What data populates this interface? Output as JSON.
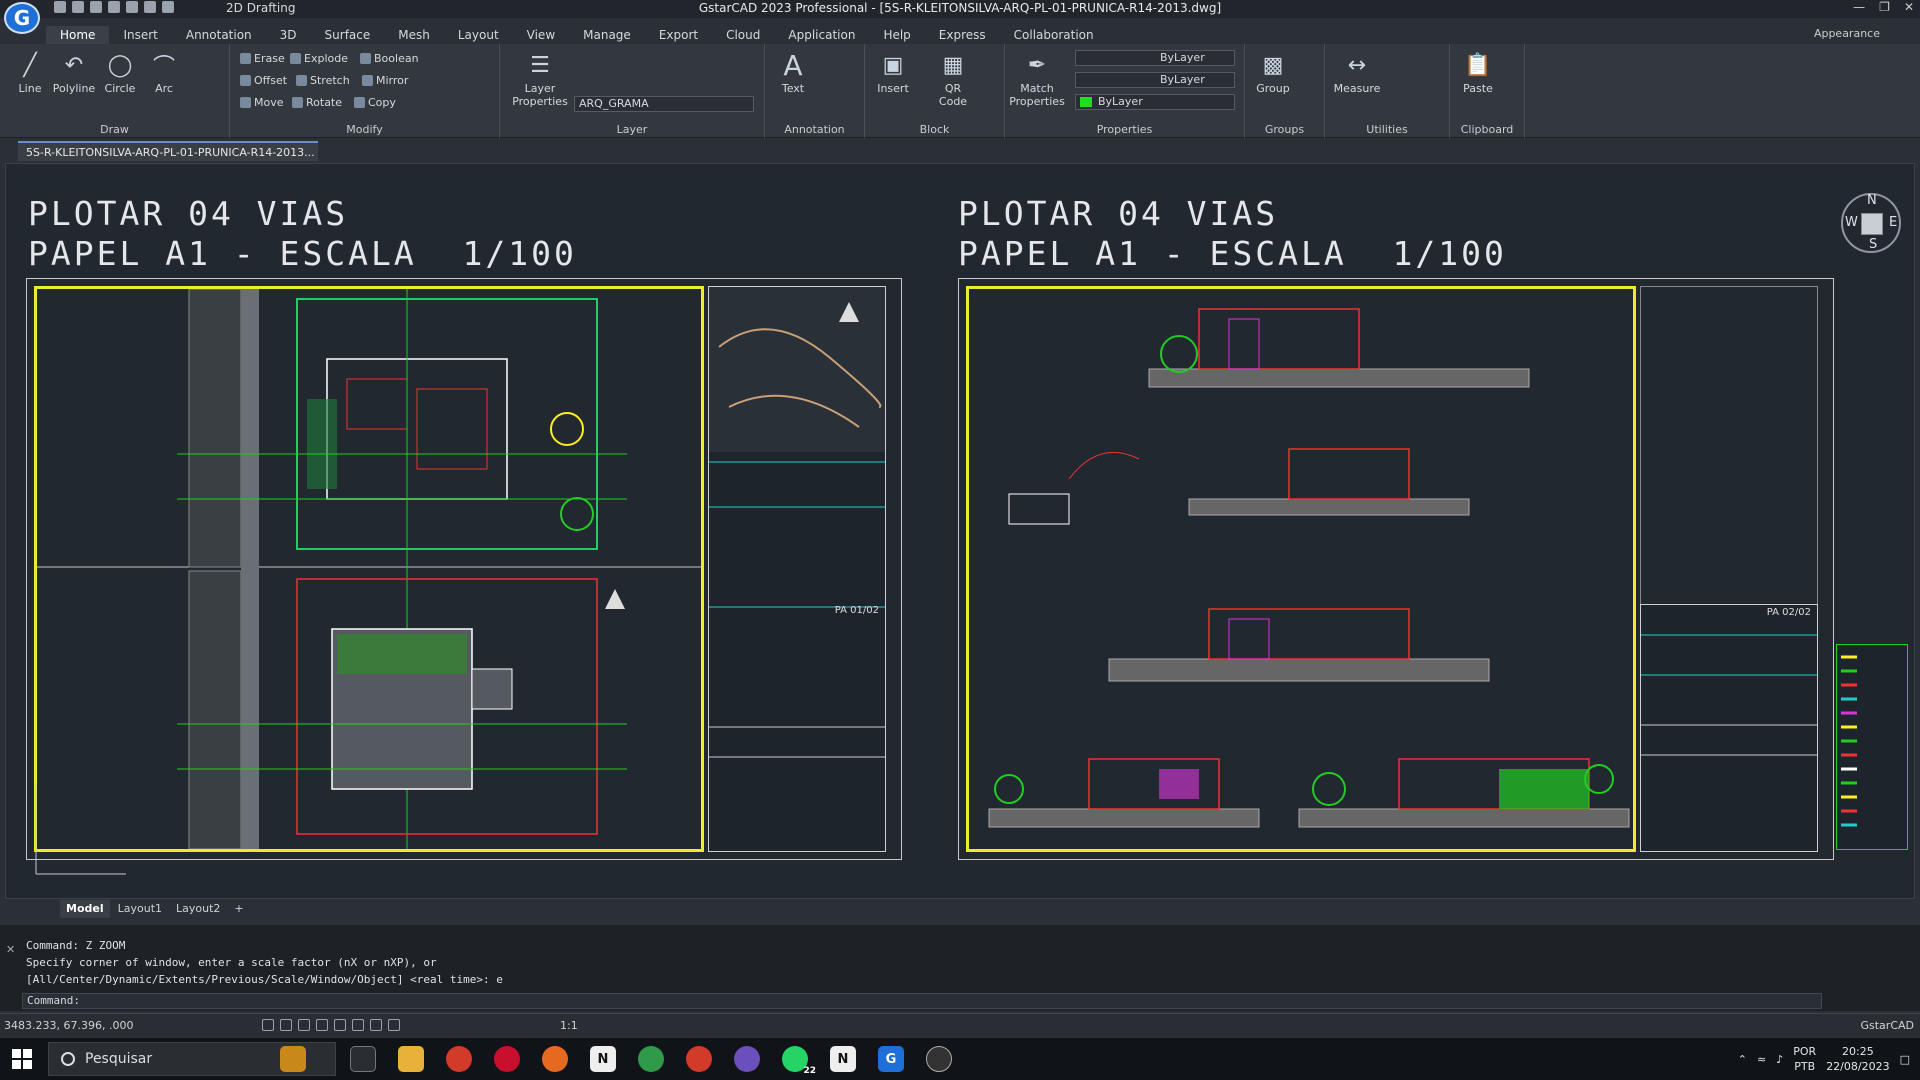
{
  "window": {
    "title": "GstarCAD 2023 Professional - [5S-R-KLEITONSILVA-ARQ-PL-01-PRUNICA-R14-2013.dwg]",
    "workspace": "2D Drafting",
    "appearance": "Appearance"
  },
  "menu": [
    "Home",
    "Insert",
    "Annotation",
    "3D",
    "Surface",
    "Mesh",
    "Layout",
    "View",
    "Manage",
    "Export",
    "Cloud",
    "Application",
    "Help",
    "Express",
    "Collaboration"
  ],
  "ribbon": {
    "draw": {
      "label": "Draw",
      "line": "Line",
      "polyline": "Polyline",
      "circle": "Circle",
      "arc": "Arc"
    },
    "modify": {
      "label": "Modify",
      "erase": "Erase",
      "explode": "Explode",
      "boolean": "Boolean",
      "offset": "Offset",
      "stretch": "Stretch",
      "mirror": "Mirror",
      "move": "Move",
      "rotate": "Rotate",
      "copy": "Copy"
    },
    "layer": {
      "label": "Layer",
      "layer_properties": "Layer Properties",
      "current_layer": "ARQ_GRAMA"
    },
    "annotation": {
      "label": "Annotation",
      "text": "Text"
    },
    "block": {
      "label": "Block",
      "insert": "Insert",
      "qr_code": "QR Code"
    },
    "properties": {
      "label": "Properties",
      "match_properties": "Match Properties",
      "bylayer1": "ByLayer",
      "bylayer2": "ByLayer",
      "bylayer3": "ByLayer"
    },
    "groups": {
      "label": "Groups",
      "group": "Group"
    },
    "utilities": {
      "label": "Utilities",
      "measure": "Measure"
    },
    "clipboard": {
      "label": "Clipboard",
      "paste": "Paste"
    }
  },
  "document_tab": "5S-R-KLEITONSILVA-ARQ-PL-01-PRUNICA-R14-2013...",
  "drawing": {
    "left_title_1": "PLOTAR 04 VIAS",
    "left_title_2": "PAPEL A1 - ESCALA  1/100",
    "right_title_1": "PLOTAR 04 VIAS",
    "right_title_2": "PAPEL A1 - ESCALA  1/100",
    "sheet_left_code": "PA 01/02",
    "sheet_right_code": "PA 02/02",
    "compass": {
      "n": "N",
      "s": "S",
      "e": "E",
      "w": "W"
    }
  },
  "layout_tabs": [
    "Model",
    "Layout1",
    "Layout2",
    "+"
  ],
  "command": {
    "line1": "Command: Z ZOOM",
    "line2": "Specify corner of window, enter a scale factor (nX or nXP), or",
    "line3": "[All/Center/Dynamic/Extents/Previous/Scale/Window/Object] <real time>: e",
    "prompt": "Command:"
  },
  "status": {
    "coords": "3483.233, 67.396, .000",
    "scale": "1:1",
    "brand": "GstarCAD"
  },
  "taskbar": {
    "search": "Pesquisar",
    "lang1": "POR",
    "lang2": "PTB",
    "time": "20:25",
    "date": "22/08/2023",
    "whatsapp_badge": "22"
  },
  "colors": {
    "frame": "#ecec2a",
    "canvas": "#212830",
    "accent": "#1e6fd8"
  }
}
